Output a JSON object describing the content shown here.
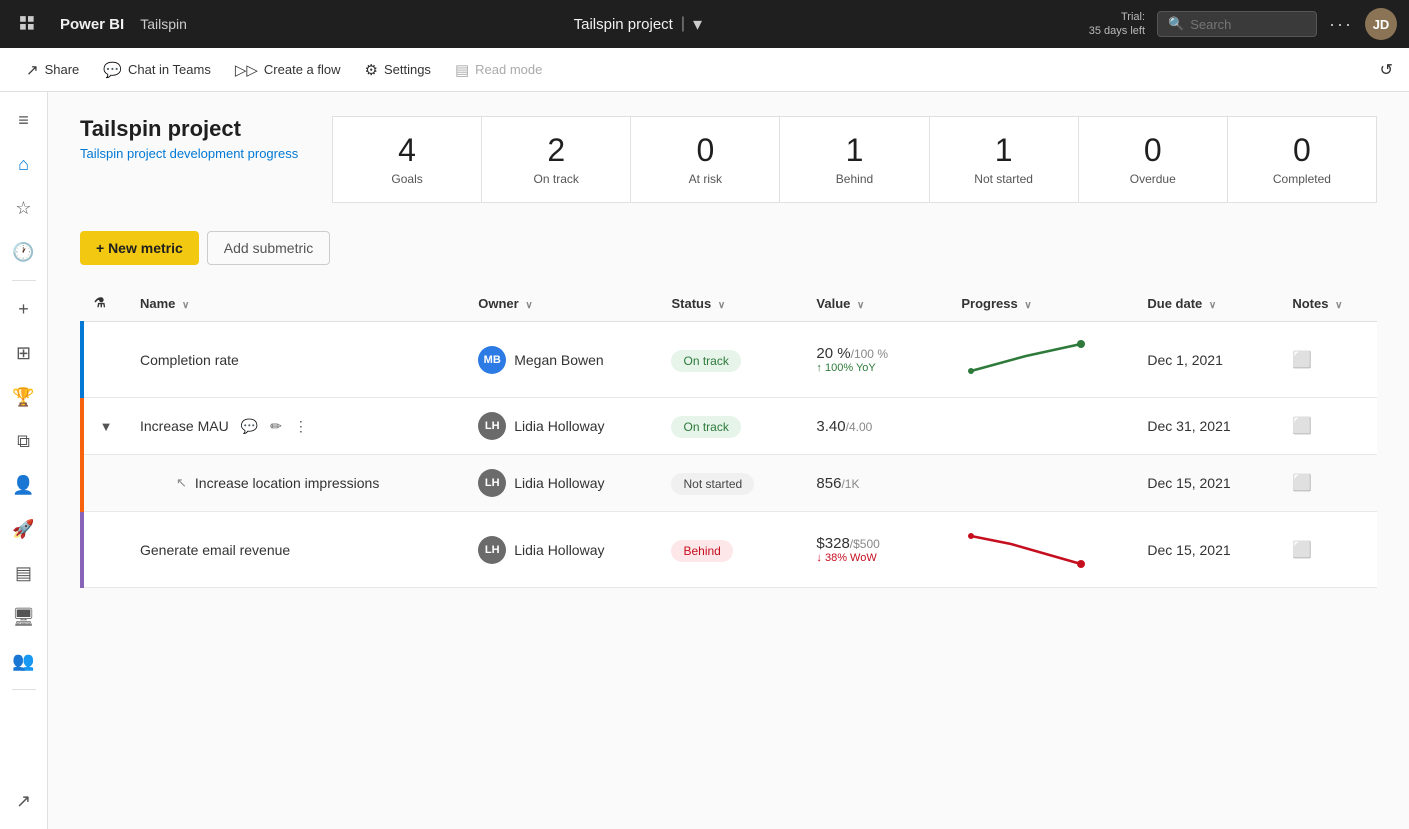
{
  "topbar": {
    "logo": "Power BI",
    "appname": "Tailspin",
    "project_title": "Tailspin project",
    "dropdown_icon": "▾",
    "trial_line1": "Trial:",
    "trial_line2": "35 days left",
    "search_placeholder": "Search",
    "more_icon": "···",
    "avatar_alt": "User avatar"
  },
  "toolbar": {
    "share_label": "Share",
    "chat_label": "Chat in Teams",
    "flow_label": "Create a flow",
    "settings_label": "Settings",
    "readmode_label": "Read mode",
    "refresh_icon": "↺"
  },
  "leftnav": {
    "icons": [
      "≡",
      "⌂",
      "★",
      "🕐",
      "+",
      "▣",
      "🏆",
      "▦",
      "👤",
      "🚀",
      "▤",
      "🖥",
      "👥"
    ]
  },
  "project": {
    "title": "Tailspin project",
    "subtitle": "Tailspin project development progress"
  },
  "stats": [
    {
      "number": "4",
      "label": "Goals"
    },
    {
      "number": "2",
      "label": "On track"
    },
    {
      "number": "0",
      "label": "At risk"
    },
    {
      "number": "1",
      "label": "Behind"
    },
    {
      "number": "1",
      "label": "Not started"
    },
    {
      "number": "0",
      "label": "Overdue"
    },
    {
      "number": "0",
      "label": "Completed"
    }
  ],
  "actions": {
    "new_metric": "+ New metric",
    "add_submetric": "Add submetric"
  },
  "table": {
    "columns": {
      "name": "Name",
      "owner": "Owner",
      "status": "Status",
      "value": "Value",
      "progress": "Progress",
      "duedate": "Due date",
      "notes": "Notes"
    },
    "rows": [
      {
        "id": "completion-rate",
        "indicator_color": "#0078d4",
        "name": "Completion rate",
        "owner_initials": "MB",
        "owner_name": "Megan Bowen",
        "owner_avatar_class": "avatar-mb",
        "status": "On track",
        "status_class": "status-ontrack",
        "value_main": "20 %",
        "value_secondary": "/100 %",
        "value_yoy": "↑ 100% YoY",
        "value_yoy_class": "value-yoy",
        "duedate": "Dec 1, 2021",
        "has_chart": true,
        "chart_type": "line-up",
        "has_expand": false,
        "is_submetric": false
      },
      {
        "id": "increase-mau",
        "indicator_color": "#f7630c",
        "name": "Increase MAU",
        "owner_initials": "LH",
        "owner_name": "Lidia Holloway",
        "owner_avatar_class": "avatar-lh",
        "status": "On track",
        "status_class": "status-ontrack",
        "value_main": "3.40",
        "value_secondary": "/4.00",
        "value_yoy": "",
        "duedate": "Dec 31, 2021",
        "has_chart": false,
        "has_expand": true,
        "is_submetric": false
      },
      {
        "id": "increase-location-impressions",
        "indicator_color": "#f7630c",
        "name": "Increase location impressions",
        "owner_initials": "LH",
        "owner_name": "Lidia Holloway",
        "owner_avatar_class": "avatar-lh",
        "status": "Not started",
        "status_class": "status-notstarted",
        "value_main": "856",
        "value_secondary": "/1K",
        "value_yoy": "",
        "duedate": "Dec 15, 2021",
        "has_chart": false,
        "has_expand": false,
        "is_submetric": true
      },
      {
        "id": "generate-email-revenue",
        "indicator_color": "#8764b8",
        "name": "Generate email revenue",
        "owner_initials": "LH",
        "owner_name": "Lidia Holloway",
        "owner_avatar_class": "avatar-lh",
        "status": "Behind",
        "status_class": "status-behind",
        "value_main": "$328",
        "value_secondary": "/$500",
        "value_yoy": "↓ 38% WoW",
        "value_yoy_class": "value-wow",
        "duedate": "Dec 15, 2021",
        "has_chart": true,
        "chart_type": "line-down",
        "has_expand": false,
        "is_submetric": false
      }
    ]
  }
}
